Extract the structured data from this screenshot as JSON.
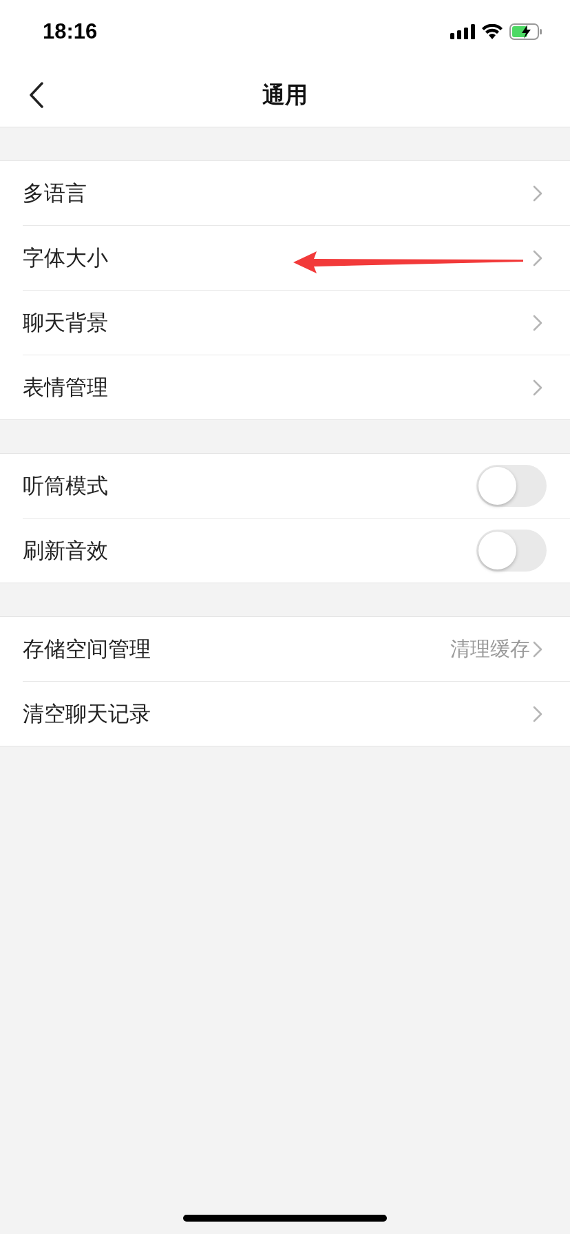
{
  "status_bar": {
    "time": "18:16"
  },
  "nav": {
    "title": "通用"
  },
  "groups": [
    {
      "items": [
        {
          "kind": "link",
          "label": "多语言"
        },
        {
          "kind": "link",
          "label": "字体大小"
        },
        {
          "kind": "link",
          "label": "聊天背景"
        },
        {
          "kind": "link",
          "label": "表情管理"
        }
      ]
    },
    {
      "items": [
        {
          "kind": "toggle",
          "label": "听筒模式",
          "on": false
        },
        {
          "kind": "toggle",
          "label": "刷新音效",
          "on": false
        }
      ]
    },
    {
      "items": [
        {
          "kind": "link",
          "label": "存储空间管理",
          "value": "清理缓存"
        },
        {
          "kind": "link",
          "label": "清空聊天记录"
        }
      ]
    }
  ]
}
